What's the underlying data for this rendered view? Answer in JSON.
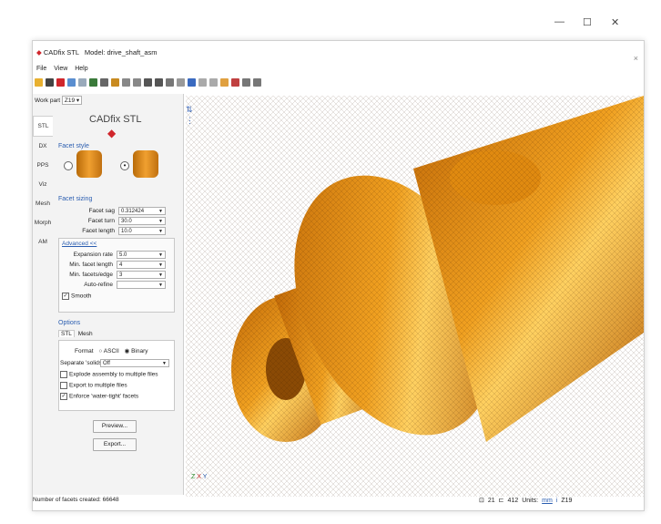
{
  "app": {
    "title": "CADfix STL",
    "model_label": "Model: drive_shaft_asm"
  },
  "window_controls": {
    "minimize": "—",
    "maximize": "☐",
    "close": "✕"
  },
  "panel_close": "×",
  "menu": [
    "File",
    "View",
    "Help"
  ],
  "work_part": {
    "label": "Work part",
    "value": "Z19"
  },
  "panel": {
    "brand": "CADfix STL",
    "tabs": [
      "STL",
      "DX",
      "PPS",
      "Viz",
      "Mesh",
      "Morph",
      "AM"
    ],
    "facet_style_title": "Facet style",
    "facet_sizing_title": "Facet sizing",
    "facet_sag": {
      "label": "Facet sag",
      "value": "0.312424"
    },
    "facet_turn": {
      "label": "Facet turn",
      "value": "30.0"
    },
    "facet_length": {
      "label": "Facet length",
      "value": "10.0"
    },
    "advanced": "Advanced <<",
    "expansion_rate": {
      "label": "Expansion rate",
      "value": "5.0"
    },
    "min_facet_length": {
      "label": "Min. facet length",
      "value": "4"
    },
    "min_facets_edge": {
      "label": "Min. facets/edge",
      "value": "3"
    },
    "auto_refine": {
      "label": "Auto-refine",
      "value": ""
    },
    "smooth": "Smooth",
    "options_title": "Options",
    "options_tabs": [
      "STL",
      "Mesh"
    ],
    "format_label": "Format",
    "format_ascii": "ASCII",
    "format_binary": "Binary",
    "separate_solids": {
      "label": "Separate 'solids'",
      "value": "Off"
    },
    "explode": "Explode assembly to multiple files",
    "export_multiple": "Export to multiple files",
    "enforce": "Enforce 'water-tight' facets",
    "preview_button": "Preview...",
    "export_button": "Export..."
  },
  "status": {
    "facets": "Number of facets created: 66648",
    "count1": "21",
    "count2": "412",
    "units_label": "Units:",
    "units_value": "mm",
    "info": "i",
    "zoom": "Z19"
  },
  "axes": {
    "x": "X",
    "y": "Y",
    "z": "Z"
  },
  "colors": {
    "accent": "#2a5db0",
    "model": "#e8890c",
    "red": "#d0262c"
  }
}
